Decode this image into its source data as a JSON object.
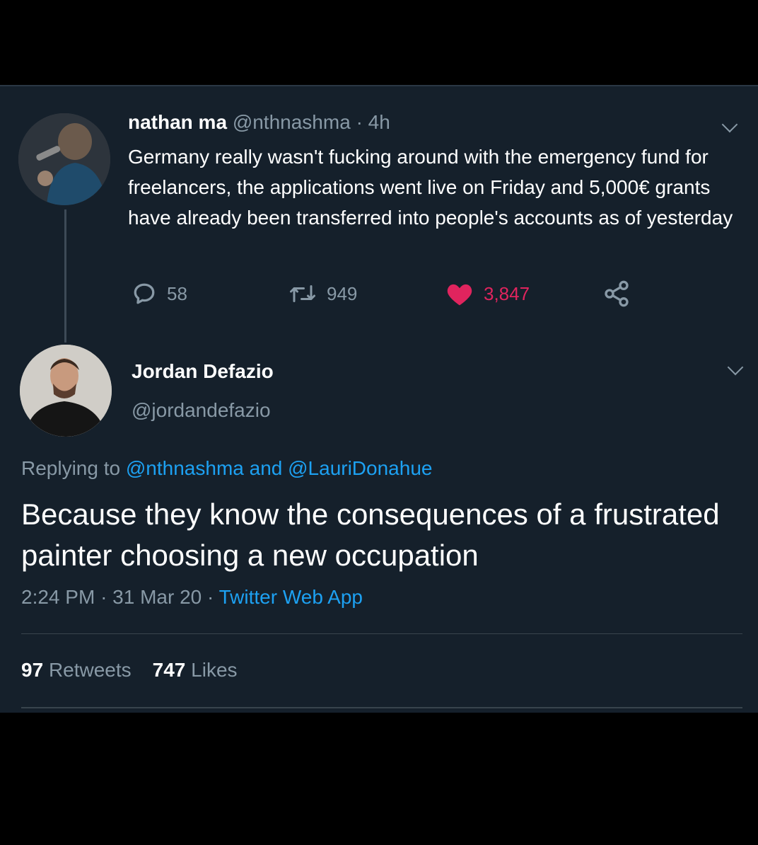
{
  "colors": {
    "background": "#15202b",
    "text": "#ffffff",
    "muted": "#8899a6",
    "link": "#1da1f2",
    "like": "#e0245e"
  },
  "parent_tweet": {
    "name": "nathan ma",
    "handle": "@nthnashma",
    "time": "· 4h",
    "text": "Germany really wasn't fucking around with the emergency fund for freelancers, the applications went live on Friday and 5,000€ grants have already been transferred into people's accounts as of yesterday",
    "replies": "58",
    "retweets": "949",
    "likes": "3,847",
    "icons": {
      "reply": "reply-icon",
      "retweet": "retweet-icon",
      "like": "heart-icon",
      "share": "share-icon",
      "menu": "chevron-down-icon"
    }
  },
  "reply_tweet": {
    "name": "Jordan Defazio",
    "handle": "@jordandefazio",
    "replying_prefix": "Replying to",
    "replying_to_1": "@nthnashma",
    "replying_and": "and",
    "replying_to_2": "@LauriDonahue",
    "text": "Because they know the consequences of a frustrated painter choosing a new occupation",
    "time": "2:24 PM",
    "date": "· 31 Mar 20 ·",
    "source": "Twitter Web App",
    "retweet_count": "97",
    "retweet_label": "Retweets",
    "like_count": "747",
    "like_label": "Likes"
  }
}
